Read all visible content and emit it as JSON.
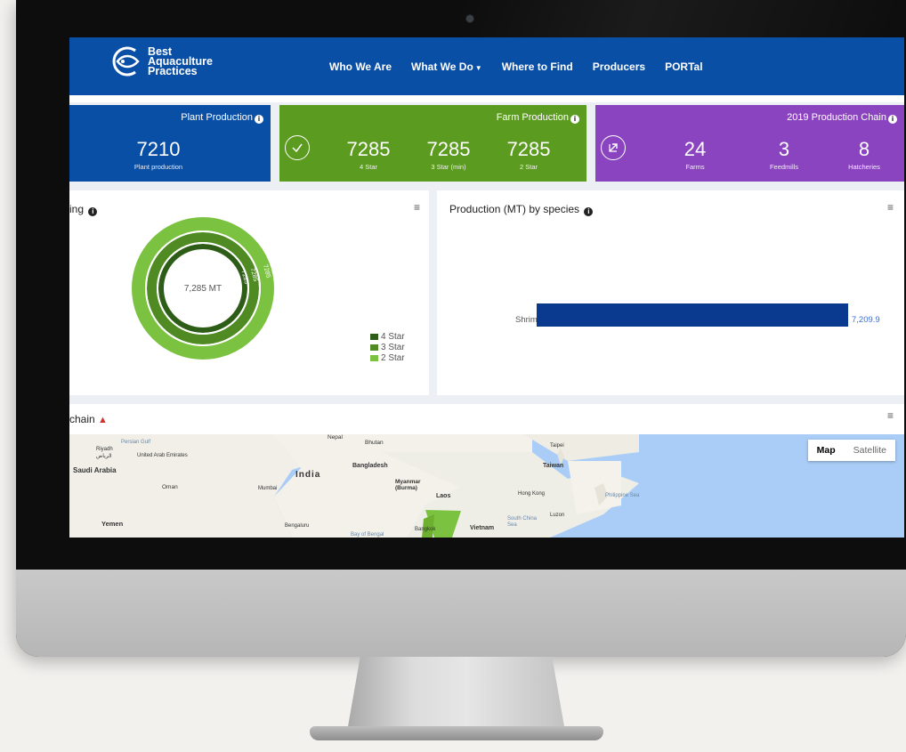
{
  "nav": {
    "logo_lines": [
      "Best",
      "Aquaculture",
      "Practices"
    ],
    "items": [
      {
        "label": "Who We Are"
      },
      {
        "label": "What We Do"
      },
      {
        "label": "Where to Find"
      },
      {
        "label": "Producers"
      },
      {
        "label": "PORTal"
      }
    ]
  },
  "cards": {
    "plant": {
      "title": "Plant Production",
      "value": "7210",
      "label": "Plant production",
      "color": "#0a4fa6"
    },
    "farm": {
      "title": "Farm Production",
      "color": "#5b9b1f",
      "stats": [
        {
          "value": "7285",
          "label": "4 Star"
        },
        {
          "value": "7285",
          "label": "3 Star (min)"
        },
        {
          "value": "7285",
          "label": "2 Star"
        }
      ]
    },
    "chain": {
      "title": "2019 Production Chain",
      "color": "#8b44bf",
      "stats": [
        {
          "value": "24",
          "label": "Farms"
        },
        {
          "value": "3",
          "label": "Feedmills"
        },
        {
          "value": "8",
          "label": "Hatcheries"
        }
      ]
    }
  },
  "donut_panel": {
    "title_visible": "ing",
    "center_label": "7,285 MT",
    "rings": [
      {
        "label": "7285",
        "color": "#2e5d18"
      },
      {
        "label": "7285",
        "color": "#4f8b22"
      },
      {
        "label": "7285",
        "color": "#7cc241"
      }
    ],
    "legend": [
      {
        "label": "4 Star",
        "color": "#2e5d18"
      },
      {
        "label": "3 Star",
        "color": "#4f8b22"
      },
      {
        "label": "2 Star",
        "color": "#7cc241"
      }
    ]
  },
  "species_panel": {
    "title": "Production (MT) by species",
    "bar_label": "Shrimp",
    "bar_value": "7,209.9"
  },
  "map_panel": {
    "title_visible": "chain",
    "toggle": {
      "map": "Map",
      "satellite": "Satellite"
    },
    "labels": [
      "Persian Gulf",
      "Riyadh",
      "الرياض",
      "United Arab Emirates",
      "Saudi Arabia",
      "Oman",
      "Yemen",
      "Nepal",
      "Bhutan",
      "India",
      "Bangladesh",
      "Mumbai",
      "Myanmar (Burma)",
      "Laos",
      "Taipei",
      "Taiwan",
      "Hong Kong",
      "Philippine Sea",
      "Luzon",
      "South China Sea",
      "Vietnam",
      "Bengaluru",
      "Bay of Bengal",
      "Bangkok"
    ]
  },
  "chart_data": [
    {
      "type": "pie",
      "title": "",
      "categories": [
        "4 Star",
        "3 Star",
        "2 Star"
      ],
      "values": [
        7285,
        7285,
        7285
      ],
      "center_label": "7,285 MT",
      "legend": "bottom-right"
    },
    {
      "type": "bar",
      "title": "Production (MT) by species",
      "categories": [
        "Shrimp"
      ],
      "values": [
        7209.9
      ],
      "orientation": "horizontal"
    }
  ]
}
